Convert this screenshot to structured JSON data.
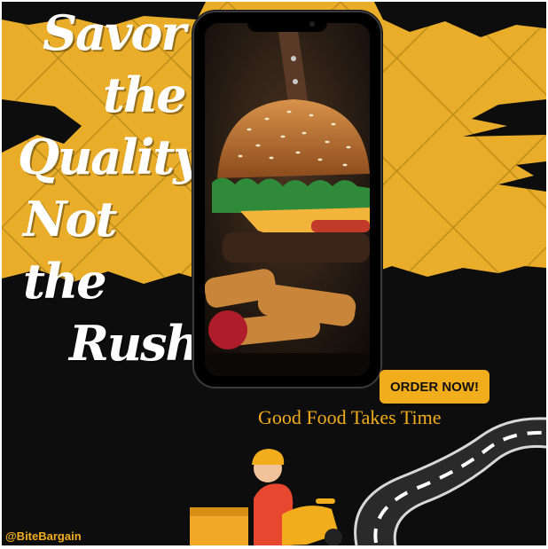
{
  "headline": {
    "line1": "Savor",
    "line2": "the",
    "line3": "Quality,",
    "line4": "Not the",
    "line5": "Rush"
  },
  "cta": {
    "label": "ORDER NOW!"
  },
  "tagline": "Good Food Takes Time",
  "social_handle": "@BiteBargain",
  "icons": {
    "food": "burger-photo",
    "road": "winding-road",
    "rider": "delivery-scooter-rider"
  },
  "colors": {
    "accent": "#f2ad1c",
    "background": "#0d0d0d",
    "text": "#ffffff"
  }
}
